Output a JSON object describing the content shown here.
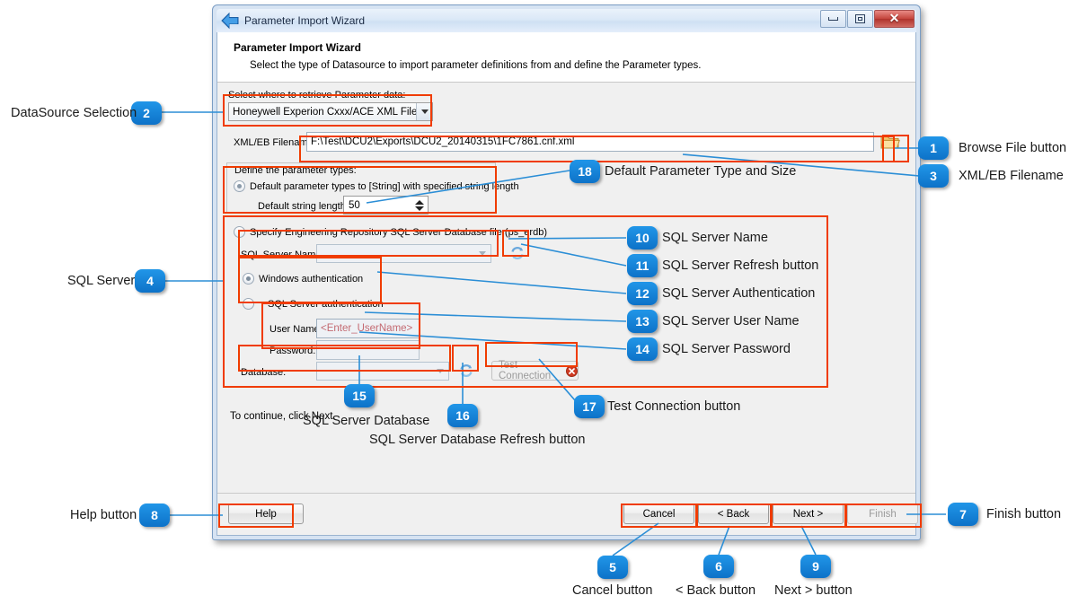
{
  "window": {
    "title": "Parameter Import Wizard",
    "back_icon": "back-arrow-icon",
    "minimize": "minimize-icon",
    "maximize": "maximize-icon",
    "close": "close-icon"
  },
  "header": {
    "title": "Parameter Import Wizard",
    "subtitle": "Select the type of Datasource to import parameter definitions from and define the Parameter types."
  },
  "datasource": {
    "label": "Select where to retrieve Parameter data:",
    "selected": "Honeywell Experion Cxxx/ACE XML File",
    "options": [
      "Honeywell Experion Cxxx/ACE XML File"
    ]
  },
  "filename": {
    "label": "XML/EB Filename:",
    "value": "F:\\Test\\DCU2\\Exports\\DCU2_20140315\\1FC7861.cnf.xml",
    "browse_icon": "folder-icon"
  },
  "param_types": {
    "group_label": "Define the parameter types:",
    "default_option": "Default parameter types to [String] with specified string length",
    "default_selected": true,
    "string_length_label": "Default string length:",
    "string_length_value": "50"
  },
  "sql": {
    "option_label": "Specify Engineering Repository SQL Server Database file (ps_erdb)",
    "option_selected": false,
    "server_name_label": "SQL Server Name:",
    "server_name_value": "",
    "server_refresh_icon": "refresh-icon",
    "windows_auth_label": "Windows authentication",
    "windows_auth_selected": true,
    "sql_auth_label": "SQL Server authentication",
    "sql_auth_selected": false,
    "user_name_label": "User Name:",
    "user_name_placeholder": "<Enter_UserName>",
    "password_label": "Password:",
    "password_value": "",
    "database_label": "Database:",
    "database_value": "",
    "database_refresh_icon": "refresh-icon",
    "test_connection_label": "Test Connection",
    "test_connection_status_icon": "error-icon"
  },
  "footer": {
    "hint": "To continue, click Next.",
    "help": "Help",
    "cancel": "Cancel",
    "back": "< Back",
    "next": "Next >",
    "finish": "Finish"
  },
  "annotations": [
    {
      "id": "a1",
      "number": "1",
      "text": "Browse File button"
    },
    {
      "id": "a2",
      "number": "2",
      "text": "DataSource Selection"
    },
    {
      "id": "a3",
      "number": "3",
      "text": "XML/EB Filename"
    },
    {
      "id": "a4",
      "number": "4",
      "text": "SQL Server"
    },
    {
      "id": "a5",
      "number": "5",
      "text": "Cancel button"
    },
    {
      "id": "a6",
      "number": "6",
      "text": "< Back button"
    },
    {
      "id": "a7",
      "number": "7",
      "text": "Finish button"
    },
    {
      "id": "a8",
      "number": "8",
      "text": "Help button"
    },
    {
      "id": "a9",
      "number": "9",
      "text": "Next > button"
    },
    {
      "id": "a10",
      "number": "10",
      "text": "SQL Server Name"
    },
    {
      "id": "a11",
      "number": "11",
      "text": "SQL Server Refresh button"
    },
    {
      "id": "a12",
      "number": "12",
      "text": "SQL Server Authentication"
    },
    {
      "id": "a13",
      "number": "13",
      "text": "SQL Server User Name"
    },
    {
      "id": "a14",
      "number": "14",
      "text": "SQL Server Password"
    },
    {
      "id": "a15",
      "number": "15",
      "text": "SQL Server Database"
    },
    {
      "id": "a16",
      "number": "16",
      "text": "SQL Server Database Refresh button"
    },
    {
      "id": "a17",
      "number": "17",
      "text": "Test Connection button"
    },
    {
      "id": "a18",
      "number": "18",
      "text": "Default Parameter Type and Size"
    }
  ],
  "colors": {
    "annotation_outline": "#f03c00",
    "callout_blue": "#1183d8",
    "leader_blue": "#2b8ed6"
  }
}
